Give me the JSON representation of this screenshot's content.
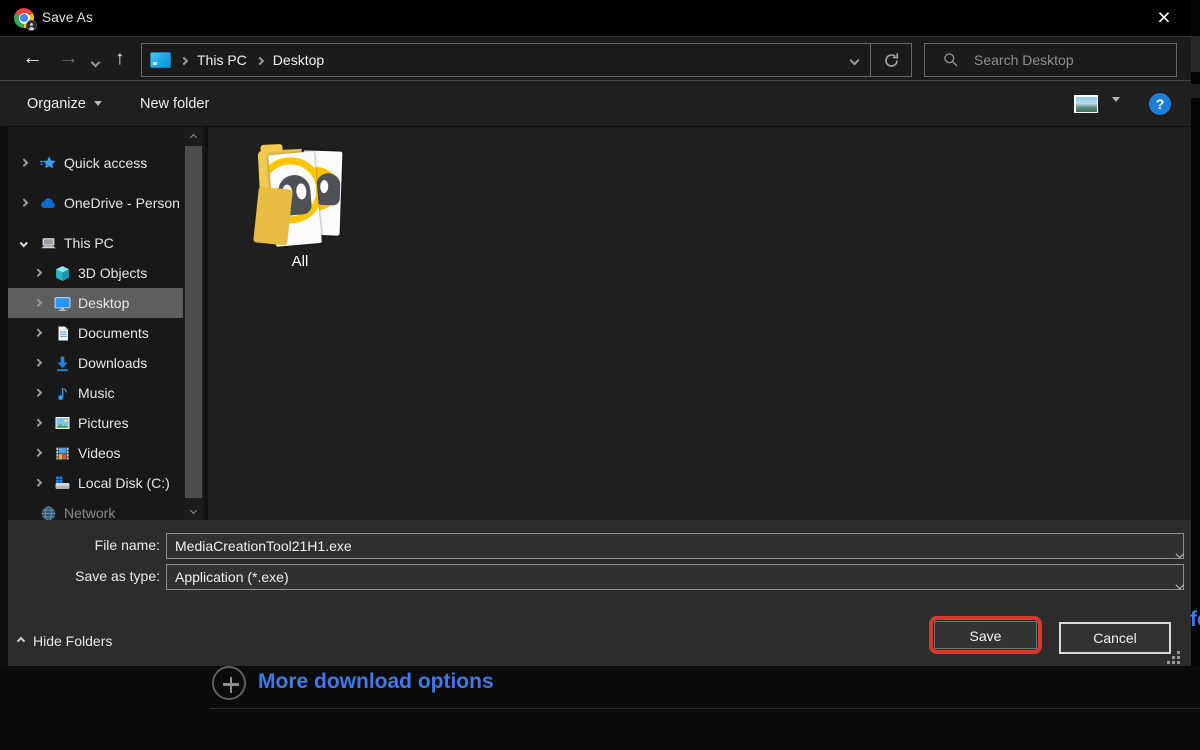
{
  "window": {
    "title": "Save As",
    "close_glyph": "×"
  },
  "nav": {
    "back_glyph": "←",
    "forward_glyph": "→",
    "up_glyph": "↑",
    "breadcrumb": [
      "This PC",
      "Desktop"
    ],
    "search_placeholder": "Search Desktop"
  },
  "toolbar": {
    "organize_label": "Organize",
    "new_folder_label": "New folder",
    "help_glyph": "?"
  },
  "sidebar": {
    "items": [
      {
        "label": "Quick access",
        "icon": "star",
        "level": 0,
        "expander": "collapsed",
        "gap_before": false
      },
      {
        "label": "OneDrive - Person",
        "icon": "cloud",
        "level": 0,
        "expander": "collapsed",
        "gap_before": true
      },
      {
        "label": "This PC",
        "icon": "computer",
        "level": 0,
        "expander": "expanded",
        "gap_before": true
      },
      {
        "label": "3D Objects",
        "icon": "cube",
        "level": 1,
        "expander": "collapsed"
      },
      {
        "label": "Desktop",
        "icon": "monitor",
        "level": 1,
        "expander": "collapsed",
        "selected": true
      },
      {
        "label": "Documents",
        "icon": "document",
        "level": 1,
        "expander": "collapsed"
      },
      {
        "label": "Downloads",
        "icon": "download",
        "level": 1,
        "expander": "collapsed"
      },
      {
        "label": "Music",
        "icon": "note",
        "level": 1,
        "expander": "collapsed"
      },
      {
        "label": "Pictures",
        "icon": "picture",
        "level": 1,
        "expander": "collapsed"
      },
      {
        "label": "Videos",
        "icon": "film",
        "level": 1,
        "expander": "collapsed"
      },
      {
        "label": "Local Disk (C:)",
        "icon": "drive",
        "level": 1,
        "expander": "collapsed"
      },
      {
        "label": "Network",
        "icon": "globe",
        "level": 0,
        "expander": "none",
        "partial": true
      }
    ]
  },
  "main": {
    "items": [
      {
        "name": "All",
        "kind": "folder"
      }
    ]
  },
  "fields": {
    "file_name_label": "File name:",
    "file_name_value": "MediaCreationTool21H1.exe",
    "save_as_type_label": "Save as type:",
    "save_as_type_value": "Application (*.exe)"
  },
  "footer": {
    "hide_folders_label": "Hide Folders",
    "save_label": "Save",
    "cancel_label": "Cancel"
  },
  "page_behind": {
    "more_options_label": "More download options",
    "partial_text": "fe"
  },
  "colors": {
    "highlight_red": "#dc372c",
    "link_blue": "#4079e8",
    "help_blue": "#1d7fd6",
    "selection_gray": "#5e5e5e",
    "folder_yellow": "#f2ca4e"
  }
}
